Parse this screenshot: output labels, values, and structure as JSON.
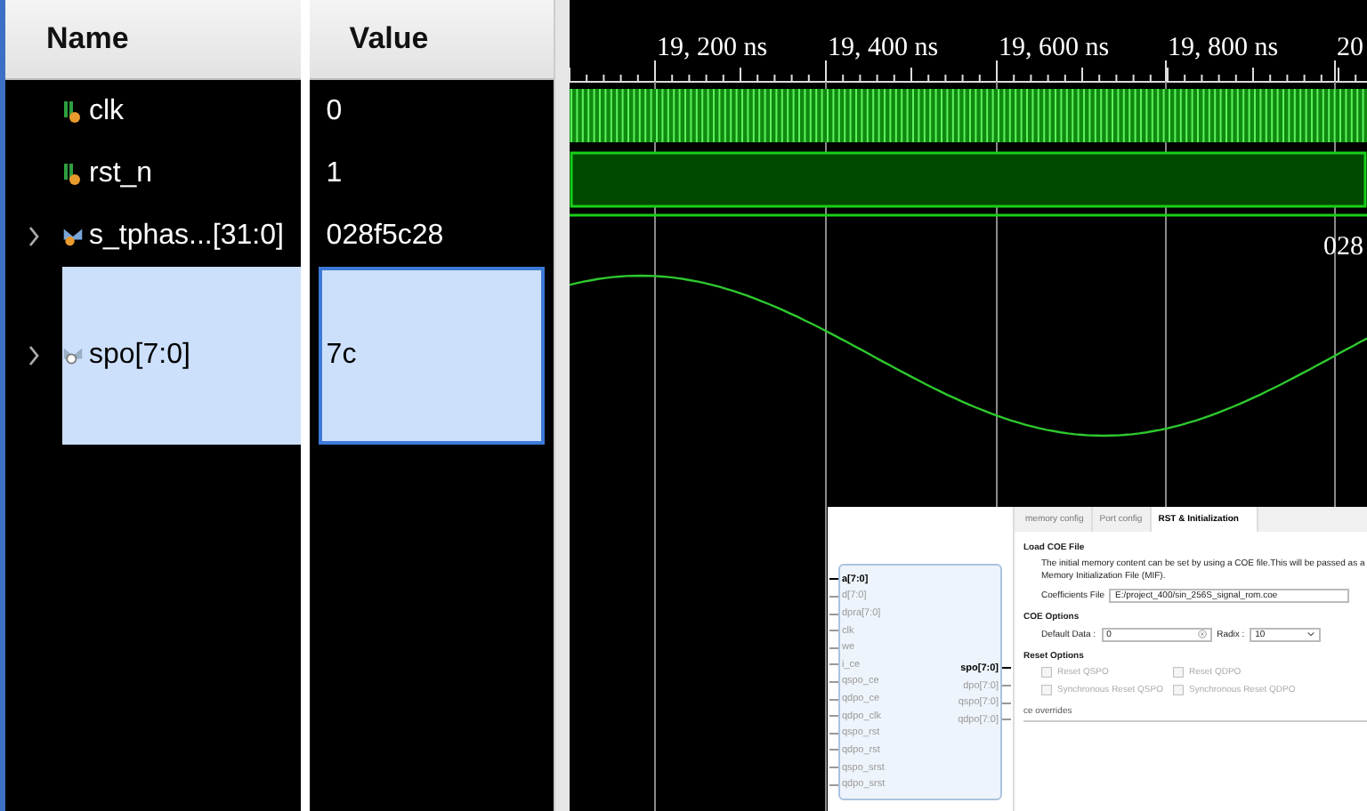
{
  "columns": [
    {
      "label": "Name"
    },
    {
      "label": "Value"
    }
  ],
  "signals": [
    {
      "name": "clk",
      "value": "0",
      "kind": "clock",
      "selected": false
    },
    {
      "name": "rst_n",
      "value": "1",
      "kind": "bit",
      "selected": false
    },
    {
      "name": "s_tphas...[31:0]",
      "value": "028f5c28",
      "kind": "bus",
      "expanded": false,
      "selected": false,
      "wave_label": "028"
    },
    {
      "name": "spo[7:0]",
      "value": "7c",
      "kind": "analog",
      "expanded": false,
      "selected": true
    }
  ],
  "timeline": {
    "ticks": [
      "19, 200 ns",
      "19, 400 ns",
      "19, 600 ns",
      "19, 800 ns",
      "20"
    ]
  },
  "ip_preview": {
    "symbol": {
      "inputs": [
        {
          "name": "a[7:0]",
          "active": true
        },
        {
          "name": "d[7:0]",
          "active": false
        },
        {
          "name": "dpra[7:0]",
          "active": false
        },
        {
          "name": "clk",
          "active": false
        },
        {
          "name": "we",
          "active": false
        },
        {
          "name": "i_ce",
          "active": false
        },
        {
          "name": "qspo_ce",
          "active": false
        },
        {
          "name": "qdpo_ce",
          "active": false
        },
        {
          "name": "qdpo_clk",
          "active": false
        },
        {
          "name": "qspo_rst",
          "active": false
        },
        {
          "name": "qdpo_rst",
          "active": false
        },
        {
          "name": "qspo_srst",
          "active": false
        },
        {
          "name": "qdpo_srst",
          "active": false
        }
      ],
      "outputs": [
        {
          "name": "spo[7:0]",
          "active": true
        },
        {
          "name": "dpo[7:0]",
          "active": false
        },
        {
          "name": "qspo[7:0]",
          "active": false
        },
        {
          "name": "qdpo[7:0]",
          "active": false
        }
      ]
    },
    "tabs": [
      {
        "label": "memory config",
        "selected": false
      },
      {
        "label": "Port config",
        "selected": false
      },
      {
        "label": "RST & Initialization",
        "selected": true
      }
    ],
    "load_coe": {
      "title": "Load COE File",
      "description": "The initial memory content can be set by using a COE file.This will be passed as a Memory Initialization File (MIF).",
      "field_label": "Coefficients File",
      "field_value": "E:/project_400/sin_256S_signal_rom.coe"
    },
    "coe_options": {
      "title": "COE Options",
      "default_data_label": "Default Data :",
      "default_data_value": "0",
      "radix_label": "Radix :",
      "radix_value": "10"
    },
    "reset_options": {
      "title": "Reset Options",
      "checkboxes": [
        {
          "label": "Reset QSPO",
          "checked": false,
          "disabled": true
        },
        {
          "label": "Reset QDPO",
          "checked": false,
          "disabled": true
        },
        {
          "label": "Synchronous Reset QSPO",
          "checked": false,
          "disabled": true
        },
        {
          "label": "Synchronous Reset QDPO",
          "checked": false,
          "disabled": true
        }
      ]
    },
    "ce_overrides": {
      "title": "ce overrides"
    }
  }
}
